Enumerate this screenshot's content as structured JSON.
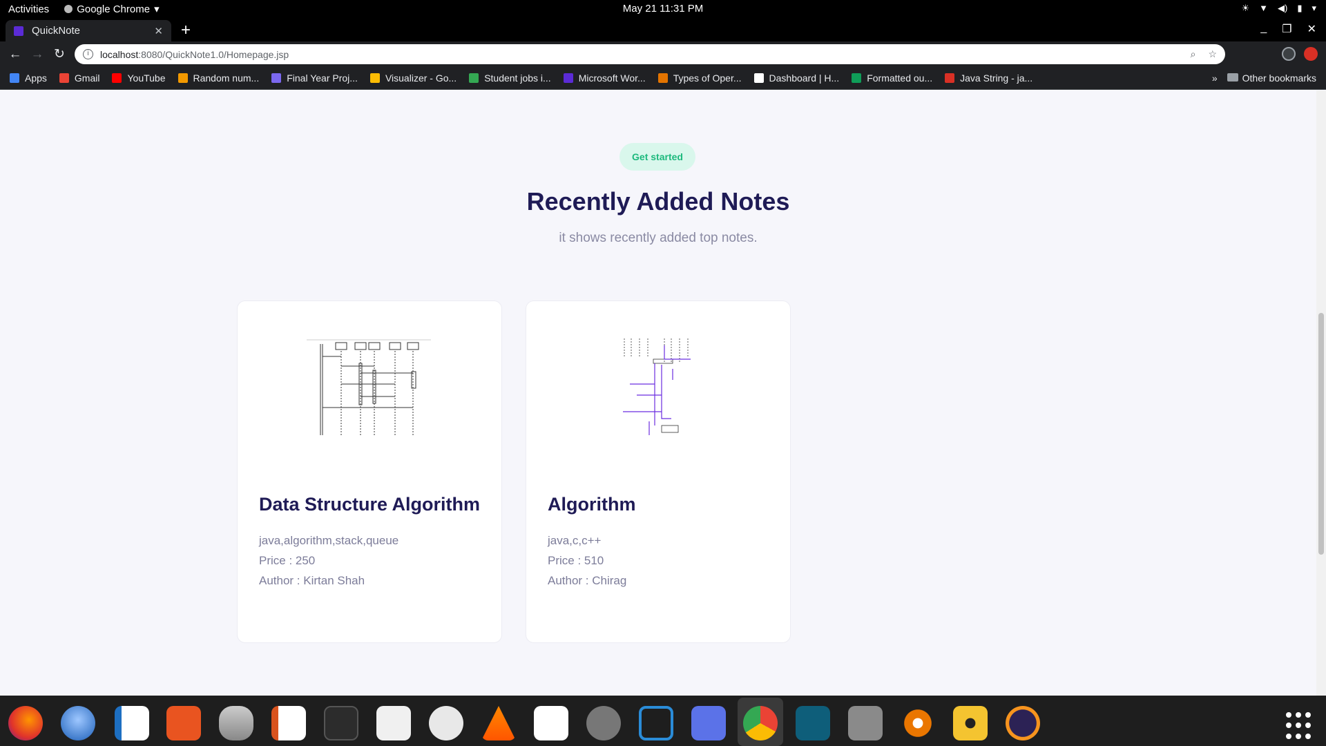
{
  "system": {
    "activities": "Activities",
    "app_name": "Google Chrome",
    "clock": "May 21  11:31 PM"
  },
  "browser": {
    "tab_title": "QuickNote",
    "url_host": "localhost",
    "url_path": ":8080/QuickNote1.0/Homepage.jsp",
    "bookmarks": [
      {
        "label": "Apps",
        "color": "#4285f4"
      },
      {
        "label": "Gmail",
        "color": "#ea4335"
      },
      {
        "label": "YouTube",
        "color": "#ff0000"
      },
      {
        "label": "Random num...",
        "color": "#f29900"
      },
      {
        "label": "Final Year Proj...",
        "color": "#7b68ee"
      },
      {
        "label": "Visualizer - Go...",
        "color": "#fbbc04"
      },
      {
        "label": "Student jobs i...",
        "color": "#34a853"
      },
      {
        "label": "Microsoft Wor...",
        "color": "#5b2bd6"
      },
      {
        "label": "Types of Oper...",
        "color": "#e37400"
      },
      {
        "label": "Dashboard | H...",
        "color": "#ffffff"
      },
      {
        "label": "Formatted ou...",
        "color": "#0f9d58"
      },
      {
        "label": "Java String - ja...",
        "color": "#d93025"
      }
    ],
    "other_bookmarks": "Other bookmarks",
    "overflow": "»"
  },
  "page": {
    "badge": "Get started",
    "heading": "Recently Added Notes",
    "subheading": "it shows recently added top notes.",
    "notes": [
      {
        "title": "Data Structure Algorithm",
        "tags": "java,algorithm,stack,queue",
        "price": "Price : 250",
        "author": "Author : Kirtan Shah"
      },
      {
        "title": "Algorithm",
        "tags": "java,c,c++",
        "price": "Price : 510",
        "author": "Author : Chirag"
      }
    ]
  },
  "dock": {
    "apps": [
      "firefox-icon",
      "thunderbird-icon",
      "writer-icon",
      "software-icon",
      "database-icon",
      "impress-icon",
      "terminal-icon",
      "files-icon",
      "image-viewer-icon",
      "vlc-icon",
      "text-editor-icon",
      "settings-icon",
      "vscode-icon",
      "screenshot-icon",
      "chrome-icon",
      "terminal2-icon",
      "gimp-icon",
      "blender-icon",
      "rhythmbox-icon",
      "eclipse-icon"
    ]
  }
}
